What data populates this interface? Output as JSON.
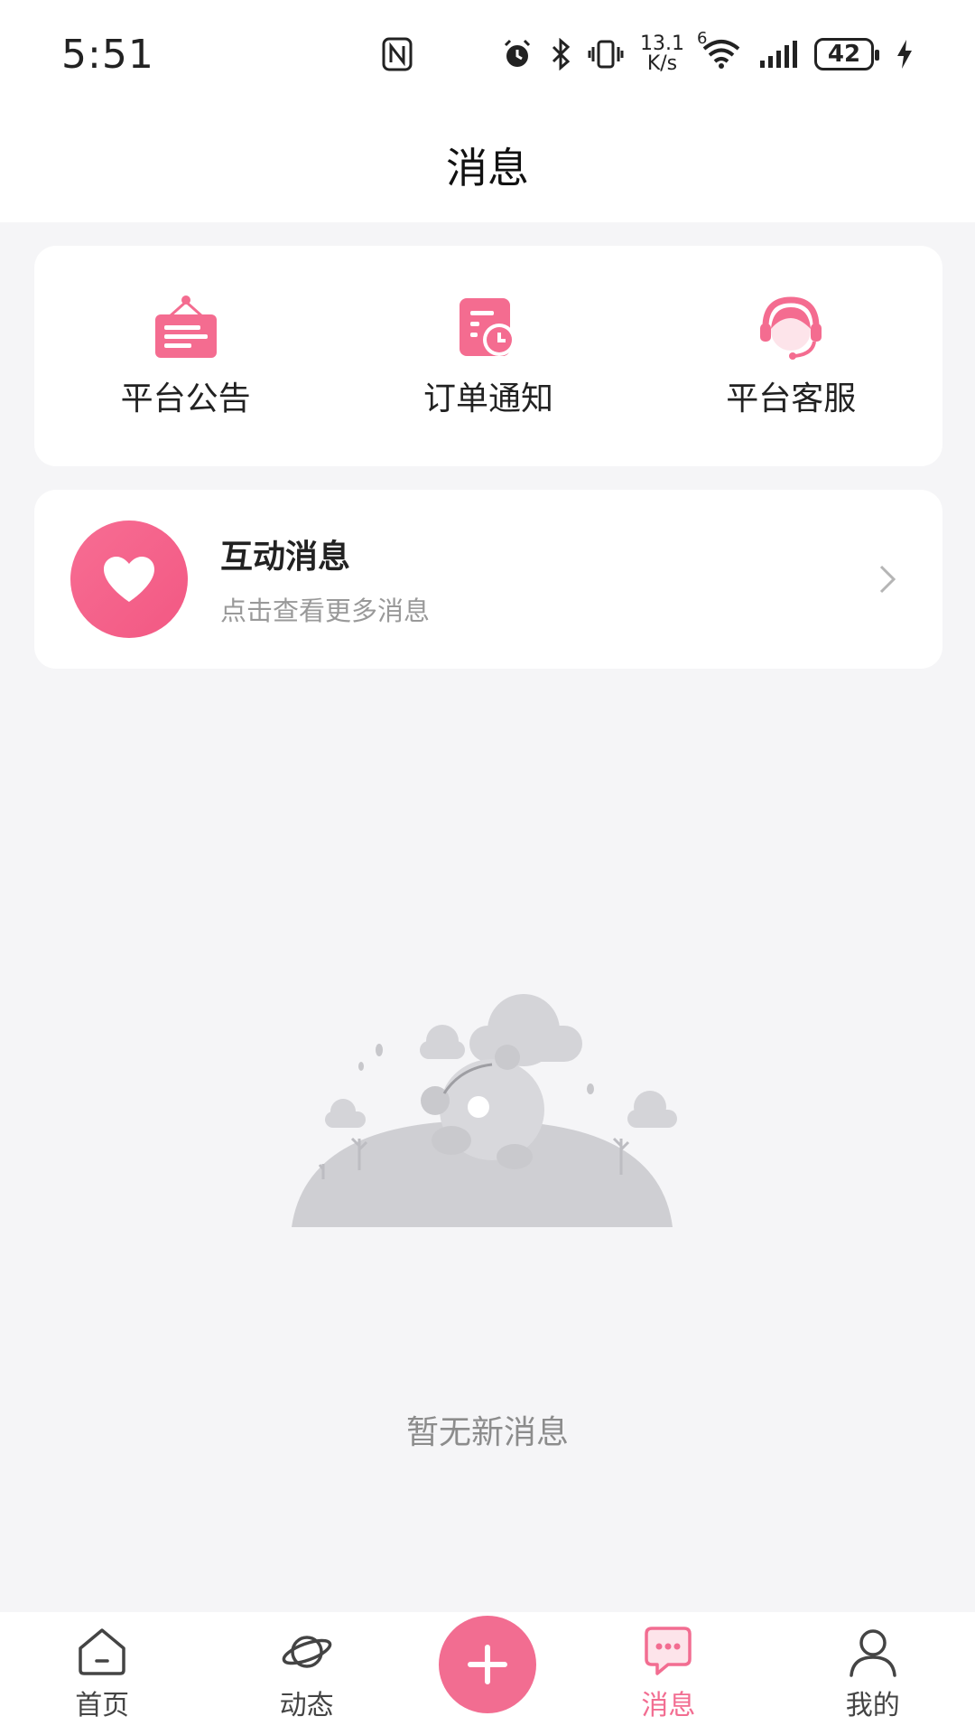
{
  "status_bar": {
    "time": "5:51",
    "speed_value": "13.1",
    "speed_unit": "K/s",
    "wifi_badge": "6",
    "battery": "42"
  },
  "header": {
    "title": "消息"
  },
  "entries": [
    {
      "label": "平台公告",
      "icon": "announcement-board-icon"
    },
    {
      "label": "订单通知",
      "icon": "order-notification-icon"
    },
    {
      "label": "平台客服",
      "icon": "customer-service-icon"
    }
  ],
  "interact": {
    "title": "互动消息",
    "subtitle": "点击查看更多消息",
    "icon": "heart-icon"
  },
  "empty_state": {
    "text": "暂无新消息"
  },
  "bottom_nav": {
    "items": [
      {
        "label": "首页",
        "icon": "home-icon"
      },
      {
        "label": "动态",
        "icon": "planet-icon"
      },
      {
        "label": "消息",
        "icon": "chat-bubble-icon",
        "active": true
      },
      {
        "label": "我的",
        "icon": "person-icon"
      }
    ],
    "add_icon": "plus-icon"
  },
  "colors": {
    "accent": "#f26d91",
    "background": "#f5f5f7",
    "card": "#ffffff",
    "muted_text": "#999999"
  }
}
